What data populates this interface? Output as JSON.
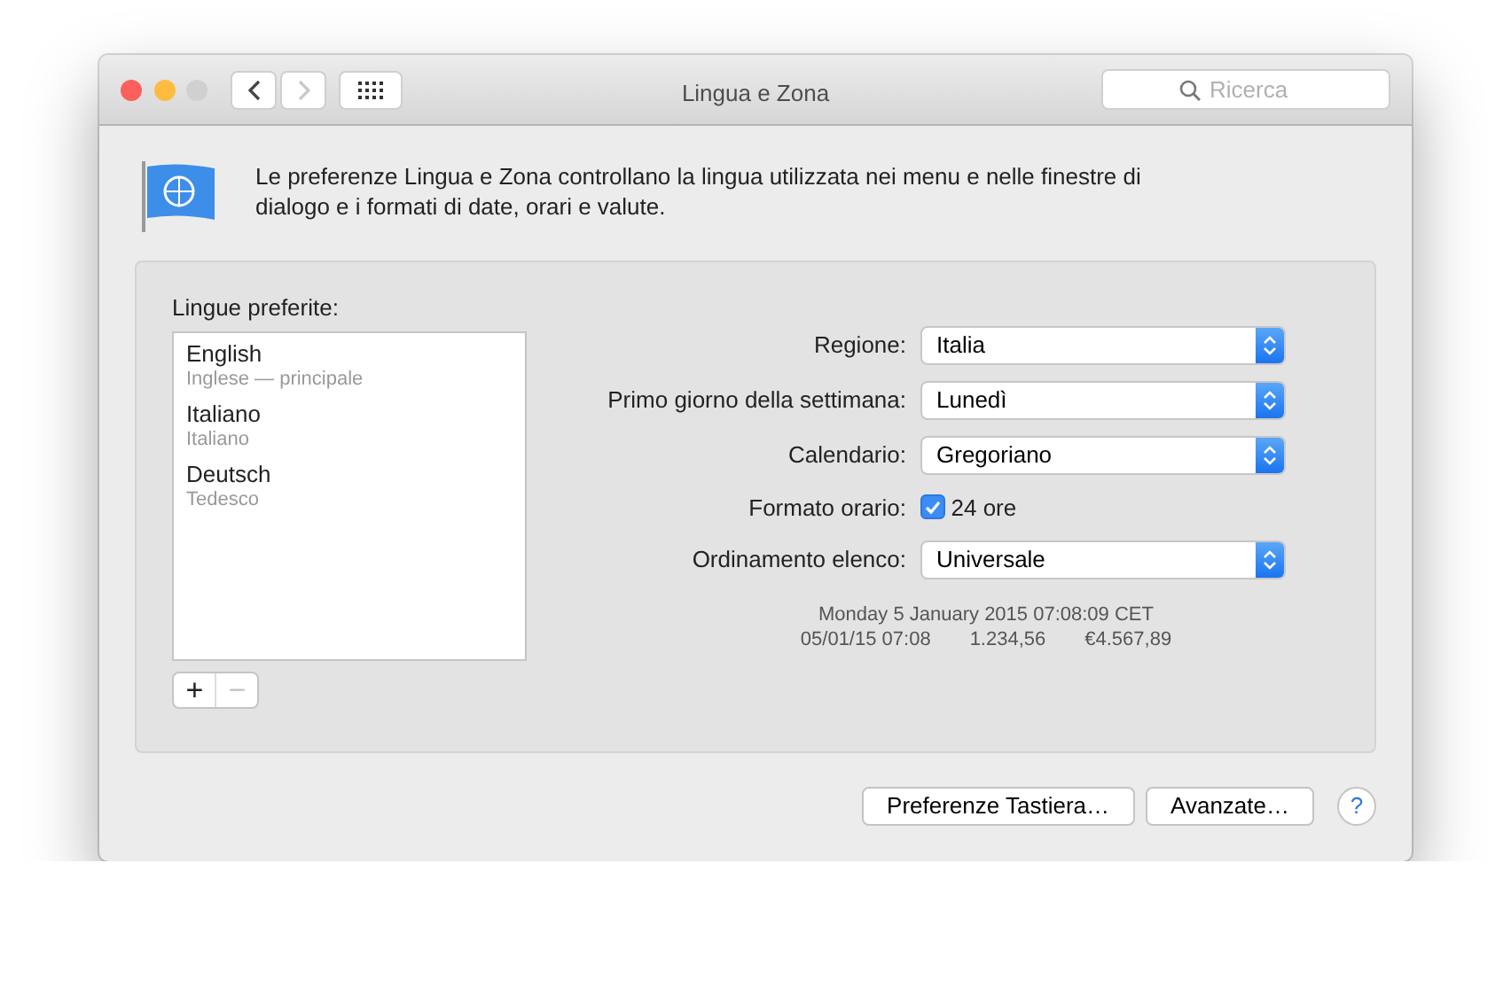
{
  "window": {
    "title": "Lingua e Zona",
    "nav": [
      {
        "kind": "back",
        "disabled": false
      },
      {
        "kind": "forward",
        "disabled": true
      }
    ],
    "search": {
      "placeholder": "Ricerca"
    }
  },
  "description": "Le preferenze Lingua e Zona controllano la lingua utilizzata nei menu e nelle finestre di dialogo e i formati di date, orari e valute.",
  "languages": {
    "label": "Lingue preferite:",
    "items": [
      {
        "name": "English",
        "detail": "Inglese — principale"
      },
      {
        "name": "Italiano",
        "detail": "Italiano"
      },
      {
        "name": "Deutsch",
        "detail": "Tedesco"
      }
    ],
    "buttons": [
      {
        "label": "+",
        "disabled": false
      },
      {
        "label": "−",
        "disabled": true
      }
    ]
  },
  "settings": [
    {
      "kind": "popup",
      "label": "Regione:",
      "value": "Italia"
    },
    {
      "kind": "popup",
      "label": "Primo giorno della settimana:",
      "value": "Lunedì"
    },
    {
      "kind": "popup",
      "label": "Calendario:",
      "value": "Gregoriano"
    },
    {
      "kind": "checkbox",
      "label": "Formato orario:",
      "value": "24 ore",
      "checked": true
    },
    {
      "kind": "popup",
      "label": "Ordinamento elenco:",
      "value": "Universale"
    }
  ],
  "sample": {
    "long_date": "Monday 5 January 2015 07:08:09 CET",
    "short": [
      "05/01/15 07:08",
      "1.234,56",
      "€4.567,89"
    ]
  },
  "buttons": [
    "Preferenze Tastiera…",
    "Avanzate…"
  ],
  "help": "?"
}
